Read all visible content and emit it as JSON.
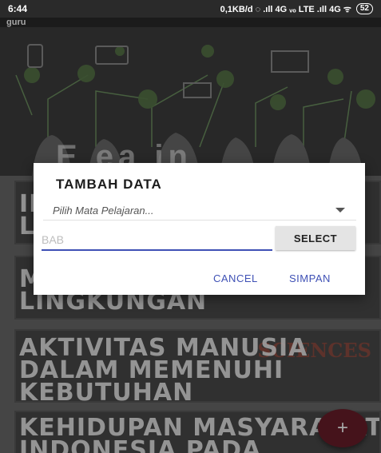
{
  "status_bar": {
    "time": "6:44",
    "indicators": "0,1KB/d ◌ .ıll 4G ᵥₒ LTE .ıll 4G ᯤ",
    "battery": "52"
  },
  "app": {
    "title": "guru"
  },
  "banner": {
    "text": "E ea in"
  },
  "cards": [
    {
      "text": "IN\nLI"
    },
    {
      "text": "M\nLINGKUNGAN"
    },
    {
      "text": "AKTIVITAS MANUSIA\nDALAM MEMENUHI\nKEBUTUHAN",
      "deco": "SCIENCES"
    },
    {
      "text": "KEHIDUPAN MASYARAKAT\nINDONESIA PADA"
    }
  ],
  "dialog": {
    "title": "TAMBAH DATA",
    "spinner_text": "Pilih Mata Pelajaran...",
    "bab_placeholder": "BAB",
    "select_label": "SELECT",
    "cancel_label": "CANCEL",
    "save_label": "SIMPAN"
  },
  "fab": {
    "icon": "add-icon",
    "label": "+"
  },
  "colors": {
    "accent": "#3f51b5",
    "fab": "#6a1e2a"
  }
}
